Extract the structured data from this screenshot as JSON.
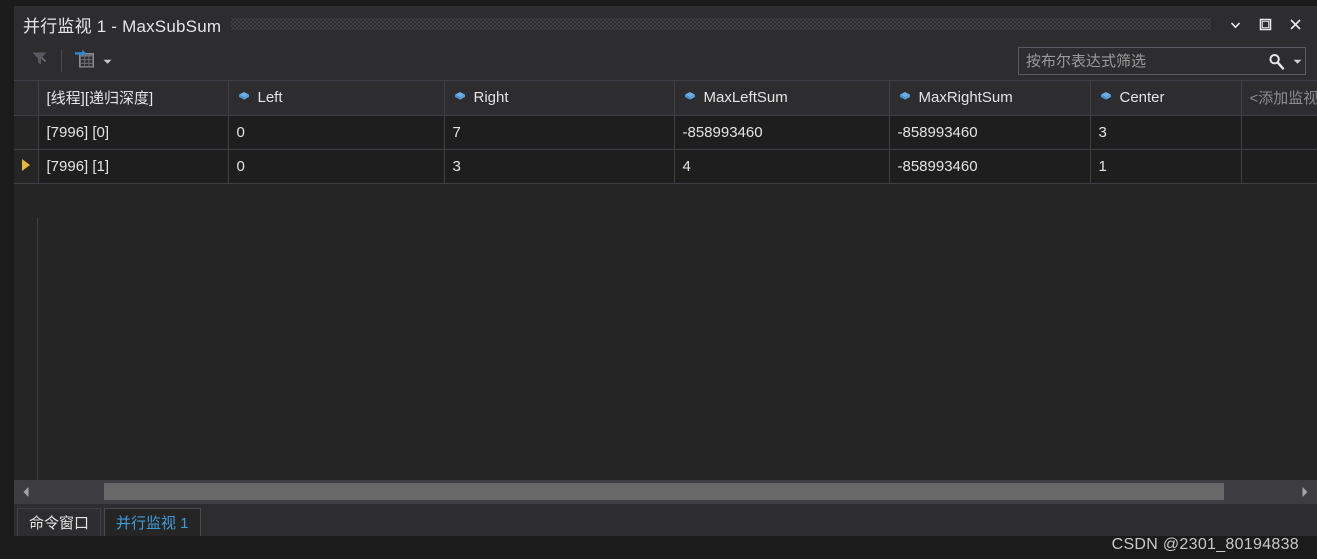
{
  "window": {
    "title": "并行监视 1 - MaxSubSum",
    "controls": [
      {
        "name": "window-dropdown-button",
        "icon": "chevron-down-icon"
      },
      {
        "name": "window-maximize-button",
        "icon": "maximize-icon"
      },
      {
        "name": "window-close-button",
        "icon": "close-icon"
      }
    ]
  },
  "toolbar": {
    "filter_button_title": "筛选",
    "group_button_title": "分组",
    "search": {
      "placeholder": "按布尔表达式筛选",
      "value": ""
    }
  },
  "grid": {
    "columns": [
      {
        "label": "[线程][递归深度]",
        "icon": ""
      },
      {
        "label": "Left",
        "icon": "variable-icon"
      },
      {
        "label": "Right",
        "icon": "variable-icon"
      },
      {
        "label": "MaxLeftSum",
        "icon": "variable-icon"
      },
      {
        "label": "MaxRightSum",
        "icon": "variable-icon"
      },
      {
        "label": "Center",
        "icon": "variable-icon"
      },
      {
        "label": "<添加监视",
        "icon": ""
      }
    ],
    "rows": [
      {
        "current": false,
        "cells": [
          {
            "text": "[7996]    [0]",
            "changed": false
          },
          {
            "text": "0",
            "changed": false
          },
          {
            "text": "7",
            "changed": false
          },
          {
            "text": "-858993460",
            "changed": false
          },
          {
            "text": "-858993460",
            "changed": false
          },
          {
            "text": "3",
            "changed": false
          },
          {
            "text": "",
            "changed": false
          }
        ]
      },
      {
        "current": true,
        "cells": [
          {
            "text": "[7996]    [1]",
            "changed": false
          },
          {
            "text": "0",
            "changed": false
          },
          {
            "text": "3",
            "changed": false
          },
          {
            "text": "4",
            "changed": true
          },
          {
            "text": "-858993460",
            "changed": false
          },
          {
            "text": "1",
            "changed": false
          },
          {
            "text": "",
            "changed": false
          }
        ]
      }
    ]
  },
  "tabs": [
    {
      "label": "命令窗口",
      "active": false
    },
    {
      "label": "并行监视 1",
      "active": true
    }
  ],
  "watermark": "CSDN @2301_80194838",
  "colors": {
    "panel_bg": "#2d2d30",
    "grid_bg": "#252526",
    "row_bg": "#1e1e1e",
    "gridline": "#3f3f46",
    "text": "#e4e4e4",
    "accent_blue": "#3f9bd8",
    "variable_icon": "#6ab0e8",
    "changed_value": "#e04343",
    "row_marker": "#e5b83c",
    "scrollbar_thumb": "#686868"
  }
}
